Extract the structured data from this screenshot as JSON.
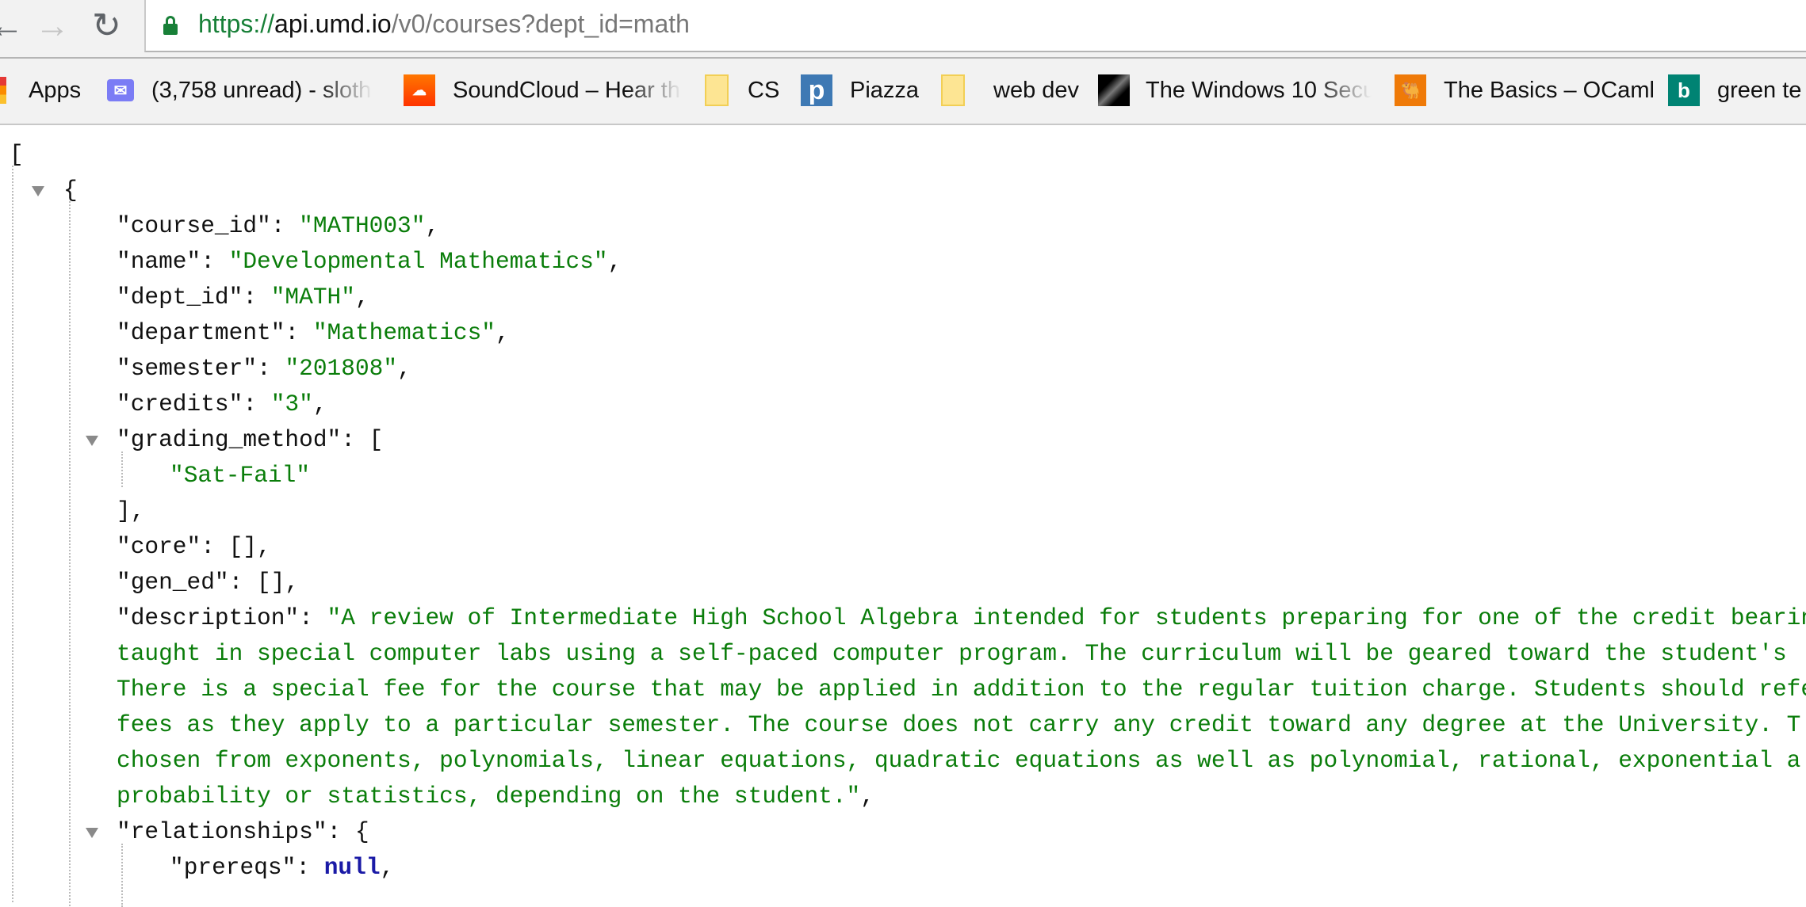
{
  "browser": {
    "url": {
      "scheme": "https://",
      "host": "api.umd.io",
      "path": "/v0/courses?dept_id=math"
    },
    "bookmarks": [
      {
        "label": "Apps",
        "icon": "apps-grid-icon"
      },
      {
        "label": "(3,758 unread) - sloth",
        "icon": "mail-icon"
      },
      {
        "label": "SoundCloud – Hear th",
        "icon": "soundcloud-icon"
      },
      {
        "label": "CS",
        "icon": "folder-icon"
      },
      {
        "label": "Piazza",
        "icon": "piazza-icon"
      },
      {
        "label": "web dev",
        "icon": "folder-icon"
      },
      {
        "label": "The Windows 10 Secu",
        "icon": "windows-article-icon"
      },
      {
        "label": "The Basics – OCaml",
        "icon": "ocaml-icon"
      },
      {
        "label": "green te",
        "icon": "bing-icon"
      }
    ]
  },
  "json_lines": {
    "l0": "[",
    "l1": "{",
    "course_id_key": "\"course_id\": ",
    "course_id": "\"MATH003\"",
    "name_key": "\"name\": ",
    "name": "\"Developmental Mathematics\"",
    "dept_id_key": "\"dept_id\": ",
    "dept_id": "\"MATH\"",
    "department_key": "\"department\": ",
    "department": "\"Mathematics\"",
    "semester_key": "\"semester\": ",
    "semester": "\"201808\"",
    "credits_key": "\"credits\": ",
    "credits": "\"3\"",
    "grading_key": "\"grading_method\": [",
    "grading_0": "\"Sat-Fail\"",
    "grading_close": "],",
    "core": "\"core\": [],",
    "gen_ed": "\"gen_ed\": [],",
    "description_key": "\"description\": ",
    "description": [
      "\"A review of Intermediate High School Algebra intended for students preparing for one of the credit bearing",
      "taught in special computer labs using a self-paced computer program. The curriculum will be geared toward the student's",
      "There is a special fee for the course that may be applied in addition to the regular tuition charge. Students should refer",
      "fees as they apply to a particular semester. The course does not carry any credit toward any degree at the University. T",
      "chosen from exponents, polynomials, linear equations, quadratic equations as well as polynomial, rational, exponential a",
      "probability or statistics, depending on the student.\""
    ],
    "relationships_key": "\"relationships\": {",
    "prereqs_key": "\"prereqs\": ",
    "prereqs": "null"
  }
}
